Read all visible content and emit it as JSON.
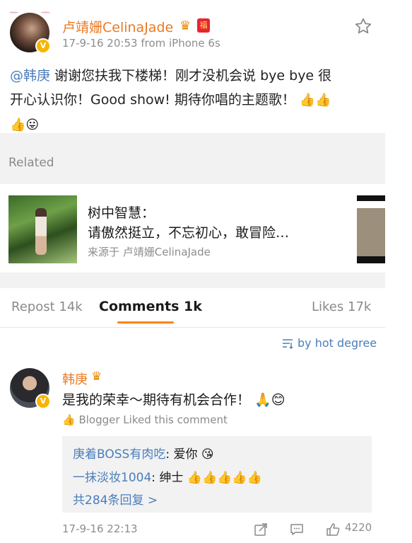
{
  "post": {
    "username": "卢靖姗CelinaJade",
    "timestamp": "17-9-16 20:53",
    "source": "from iPhone 6s",
    "mention": "@韩庚",
    "text_line1": " 谢谢您扶我下楼梯！刚才没机会说 bye bye 很",
    "text_line2": "开心认识你！Good show! 期待你唱的主题歌！",
    "colors": {
      "username": "#ea7a23",
      "link": "#4a7ebb",
      "accent": "#ff8200"
    }
  },
  "related": {
    "label": "Related",
    "title": "树中智慧：",
    "desc": "请傲然挺立，不忘初心，敢冒险…",
    "source": "来源于 卢靖姗CelinaJade"
  },
  "tabs": {
    "repost": "Repost 14k",
    "comments": "Comments 1k",
    "likes": "Likes 17k"
  },
  "sort": {
    "label": "by hot degree"
  },
  "comment": {
    "username": "韩庚",
    "text": "是我的荣幸～期待有机会合作！",
    "liked_note": "Blogger Liked this comment",
    "replies": [
      {
        "user": "庚着BOSS有肉吃",
        "text": ": 爱你"
      },
      {
        "user": "一抹淡妆1004",
        "text": ": 绅士"
      }
    ],
    "more_replies": "共284条回复 >",
    "timestamp": "17-9-16 22:13",
    "like_count": "4220"
  },
  "icons": [
    "verified-badge-icon",
    "crown-icon",
    "red-packet-icon",
    "star-icon",
    "sort-icon",
    "thumbs-up-icon",
    "share-icon",
    "comment-icon",
    "like-icon"
  ]
}
